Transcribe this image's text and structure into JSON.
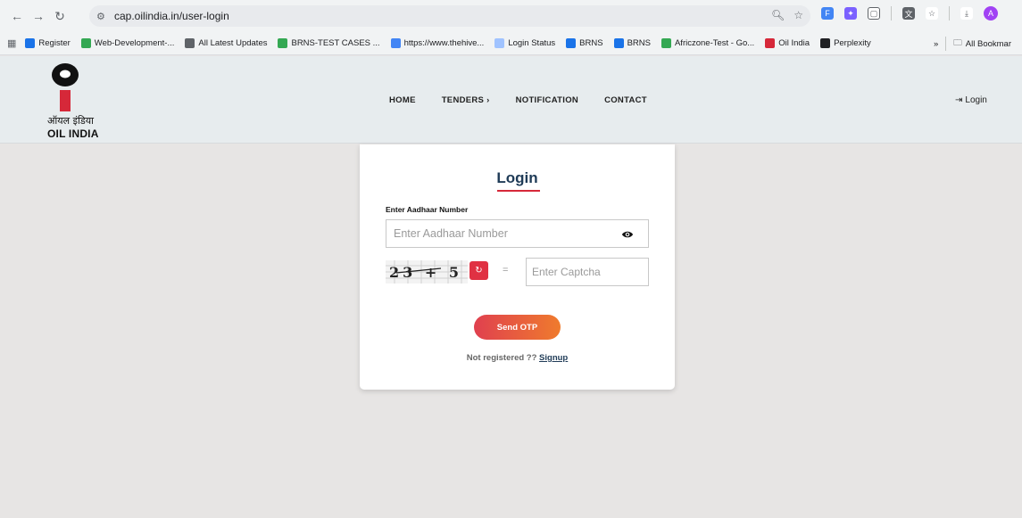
{
  "browser": {
    "url": "cap.oilindia.in/user-login",
    "bookmarks": [
      {
        "label": "Register",
        "color": "#1a73e8"
      },
      {
        "label": "Web-Development-...",
        "color": "#34a853"
      },
      {
        "label": "All Latest Updates",
        "color": "#5f6368"
      },
      {
        "label": "BRNS-TEST CASES ...",
        "color": "#34a853"
      },
      {
        "label": "https://www.thehive...",
        "color": "#4285f4"
      },
      {
        "label": "Login Status",
        "color": "#a0c3ff"
      },
      {
        "label": "BRNS",
        "color": "#1a73e8"
      },
      {
        "label": "BRNS",
        "color": "#1a73e8"
      },
      {
        "label": "Africzone-Test - Go...",
        "color": "#34a853"
      },
      {
        "label": "Oil India",
        "color": "#d62839"
      },
      {
        "label": "Perplexity",
        "color": "#202124"
      }
    ],
    "more_bookmarks": "»",
    "all_bookmarks": "All Bookmar",
    "avatar_letter": "A"
  },
  "site": {
    "logo_hindi": "ऑयल इंडिया",
    "logo_english": "OIL INDIA",
    "nav": [
      "HOME",
      "TENDERS ›",
      "NOTIFICATION",
      "CONTACT"
    ],
    "login_link": "Login",
    "brand_red": "#d62839"
  },
  "login": {
    "title": "Login",
    "aadhaar_label": "Enter Aadhaar Number",
    "aadhaar_placeholder": "Enter Aadhaar Number",
    "captcha_text": "23 + 5",
    "equals": "=",
    "captcha_placeholder": "Enter Captcha",
    "send_otp": "Send OTP",
    "not_registered": "Not registered ??",
    "signup": "Signup"
  }
}
